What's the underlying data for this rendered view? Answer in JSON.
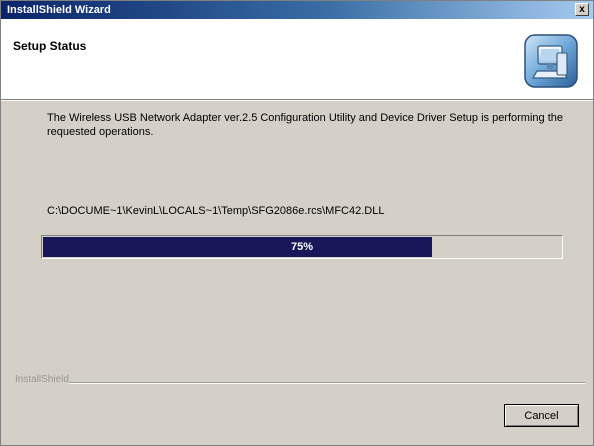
{
  "window": {
    "title": "InstallShield Wizard",
    "close_glyph": "x"
  },
  "header": {
    "title": "Setup Status",
    "icon": "installer-computer-icon"
  },
  "main": {
    "status_text": "The Wireless USB Network Adapter ver.2.5 Configuration Utility and Device Driver Setup is performing the requested operations.",
    "current_file": "C:\\DOCUME~1\\KevinL\\LOCALS~1\\Temp\\SFG2086e.rcs\\MFC42.DLL",
    "progress": {
      "percent": 75,
      "label": "75%"
    }
  },
  "footer": {
    "brand": "InstallShield",
    "cancel_label": "Cancel"
  },
  "colors": {
    "progress_fill": "#17175a",
    "titlebar_start": "#0a246a",
    "titlebar_end": "#a6caf0",
    "dialog_face": "#d4d0c8"
  }
}
